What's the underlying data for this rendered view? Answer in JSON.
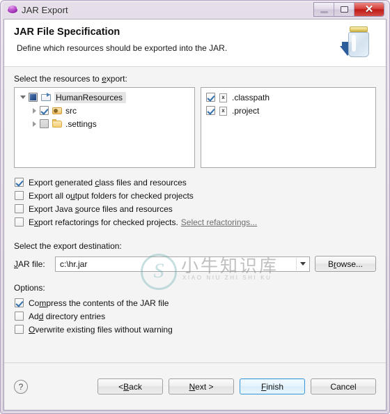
{
  "window": {
    "title": "JAR Export",
    "icon": "export-disc-icon",
    "controls": {
      "minimize": "minimize-button",
      "maximize": "maximize-button",
      "close": "close-button",
      "close_glyph": "✕"
    }
  },
  "banner": {
    "heading": "JAR File Specification",
    "subtext": "Define which resources should be exported into the JAR.",
    "icon": "jar-file-icon"
  },
  "resources": {
    "label_pre": "Select the resources to ",
    "label_underlined": "e",
    "label_post": "xport:",
    "tree": [
      {
        "label": "HumanResources",
        "icon": "project-folder-icon",
        "check": "filled",
        "twisty": "open",
        "level": 0,
        "selected": true
      },
      {
        "label": "src",
        "icon": "package-folder-icon",
        "check": "checked",
        "twisty": "closed",
        "level": 1,
        "selected": false
      },
      {
        "label": ".settings",
        "icon": "folder-icon",
        "check": "grayed",
        "twisty": "closed",
        "level": 1,
        "selected": false
      }
    ],
    "files": [
      {
        "label": ".classpath",
        "icon": "xml-file-icon",
        "check": "checked"
      },
      {
        "label": ".project",
        "icon": "xml-file-icon",
        "check": "checked"
      }
    ]
  },
  "export_options": [
    {
      "pre": "Export generated ",
      "mnemonic": "c",
      "post": "lass files and resources",
      "checked": true,
      "name": "export-generated-class-files-checkbox"
    },
    {
      "pre": "Export all o",
      "mnemonic": "u",
      "post": "tput folders for checked projects",
      "checked": false,
      "name": "export-all-output-folders-checkbox"
    },
    {
      "pre": "Export Java ",
      "mnemonic": "s",
      "post": "ource files and resources",
      "checked": false,
      "name": "export-java-source-files-checkbox"
    },
    {
      "pre": "E",
      "mnemonic": "x",
      "post": "port refactorings for checked projects.",
      "checked": false,
      "name": "export-refactorings-checkbox",
      "link": "Select refactorings..."
    }
  ],
  "destination": {
    "label": "Select the export destination:",
    "field_label_pre": "",
    "field_label_mnemonic": "J",
    "field_label_post": "AR file:",
    "value": "c:\\hr.jar",
    "placeholder": "",
    "browse_pre": "B",
    "browse_mnemonic": "r",
    "browse_post": "owse..."
  },
  "options": {
    "label": "Options:",
    "items": [
      {
        "pre": "Co",
        "mnemonic": "m",
        "post": "press the contents of the JAR file",
        "checked": true,
        "name": "compress-contents-checkbox"
      },
      {
        "pre": "Ad",
        "mnemonic": "d",
        "post": " directory entries",
        "checked": false,
        "name": "add-directory-entries-checkbox"
      },
      {
        "pre": "",
        "mnemonic": "O",
        "post": "verwrite existing files without warning",
        "checked": false,
        "name": "overwrite-existing-files-checkbox"
      }
    ]
  },
  "buttonbar": {
    "help_glyph": "?",
    "back_pre": "< ",
    "back_mnemonic": "B",
    "back_post": "ack",
    "next_pre": "",
    "next_mnemonic": "N",
    "next_post": "ext >",
    "finish_pre": "",
    "finish_mnemonic": "F",
    "finish_post": "inish",
    "cancel": "Cancel"
  },
  "watermark": {
    "chinese": "小牛知识库",
    "pinyin": "XIAO NIU ZHI SHI KU"
  },
  "colors": {
    "frame": "#ddd4e2",
    "accent_blue": "#3c9ad6",
    "close_red": "#d6413a",
    "check_blue": "#2f6fae"
  }
}
